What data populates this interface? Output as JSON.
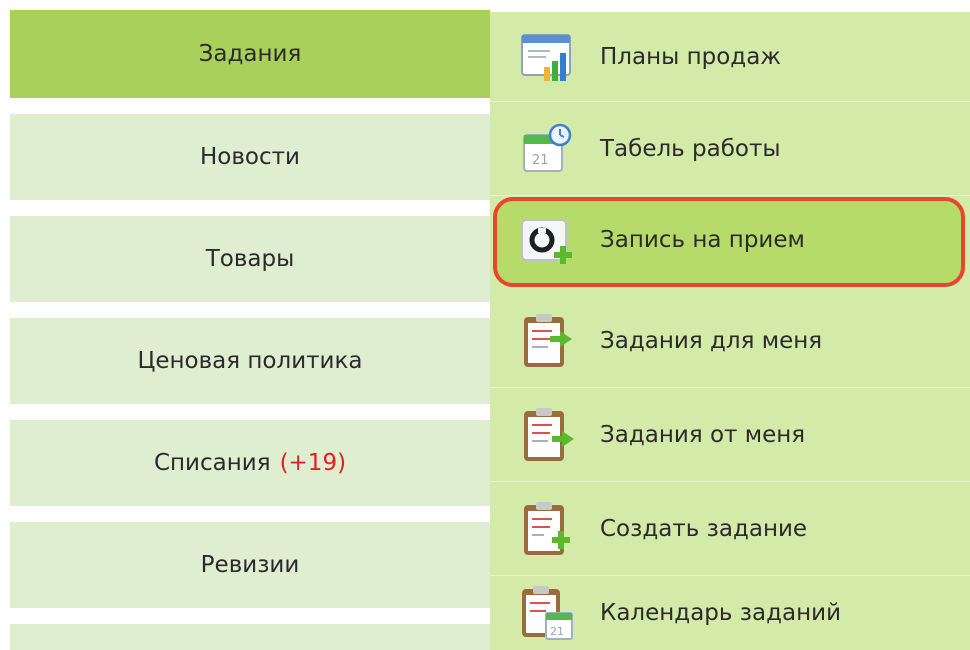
{
  "left_menu": {
    "items": [
      {
        "label": "Задания",
        "active": true
      },
      {
        "label": "Новости"
      },
      {
        "label": "Товары"
      },
      {
        "label": "Ценовая политика"
      },
      {
        "label": "Списания",
        "badge": "(+19)"
      },
      {
        "label": "Ревизии"
      }
    ]
  },
  "submenu": {
    "items": [
      {
        "label": "Планы продаж",
        "icon": "sales-plan-icon"
      },
      {
        "label": "Табель работы",
        "icon": "calendar-clock-icon",
        "icon_text": "21"
      },
      {
        "label": "Запись на прием",
        "icon": "appointment-add-icon",
        "highlighted": true
      },
      {
        "label": "Задания для меня",
        "icon": "clipboard-incoming-icon"
      },
      {
        "label": "Задания от меня",
        "icon": "clipboard-outgoing-icon"
      },
      {
        "label": "Создать задание",
        "icon": "clipboard-add-icon"
      },
      {
        "label": "Календарь заданий",
        "icon": "clipboard-calendar-icon",
        "icon_text": "21"
      }
    ]
  },
  "colors": {
    "active": "#a9d05a",
    "inactive": "#dfeed0",
    "submenu_bg": "#d3eaa8",
    "highlight_border": "#e8462c",
    "badge": "#e3201b"
  }
}
